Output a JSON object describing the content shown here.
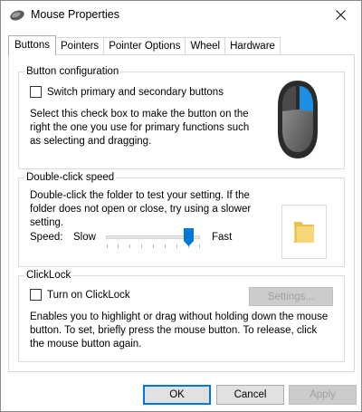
{
  "window": {
    "title": "Mouse Properties"
  },
  "tabs": [
    {
      "label": "Buttons",
      "active": true
    },
    {
      "label": "Pointers",
      "active": false
    },
    {
      "label": "Pointer Options",
      "active": false
    },
    {
      "label": "Wheel",
      "active": false
    },
    {
      "label": "Hardware",
      "active": false
    }
  ],
  "button_config": {
    "title": "Button configuration",
    "checkbox_label": "Switch primary and secondary buttons",
    "checked": false,
    "description_lines": [
      "Select this check box to make the button on the",
      "right the one you use for primary functions such",
      "as selecting and dragging."
    ]
  },
  "double_click": {
    "title": "Double-click speed",
    "description_lines": [
      "Double-click the folder to test your setting. If the",
      "folder does not open or close, try using a slower",
      "setting."
    ],
    "speed_label": "Speed:",
    "slow_label": "Slow",
    "fast_label": "Fast",
    "slider_value_fraction": 0.88
  },
  "clicklock": {
    "title": "ClickLock",
    "checkbox_label": "Turn on ClickLock",
    "checked": false,
    "settings_label": "Settings...",
    "description_lines": [
      "Enables you to highlight or drag without holding down the mouse",
      "button. To set, briefly press the mouse button. To release, click",
      "the mouse button again."
    ]
  },
  "footer": {
    "ok_label": "OK",
    "cancel_label": "Cancel",
    "apply_label": "Apply"
  },
  "icons": {
    "title_icon": "mouse-icon",
    "close_icon": "close-icon",
    "mouse_image": "mouse-illustration-icon",
    "folder_icon": "folder-icon"
  },
  "colors": {
    "accent": "#0078d7",
    "mouse_primary_button": "#1e8fe6",
    "folder": "#f6d676"
  }
}
